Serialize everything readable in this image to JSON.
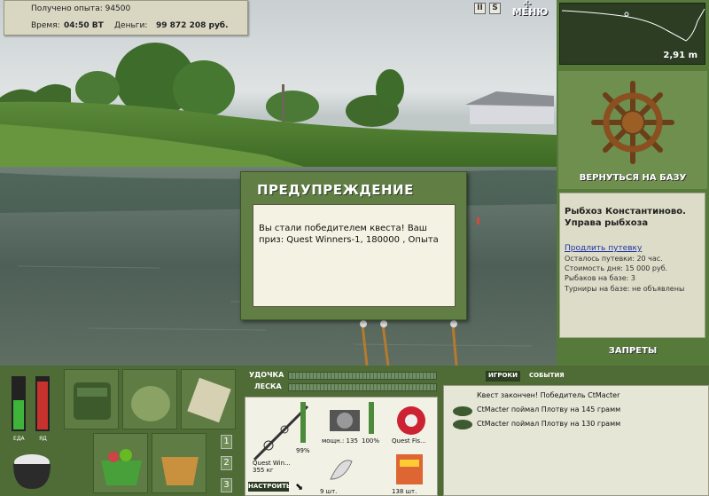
{
  "info": {
    "experience": "Получено опыта: 94500",
    "time_label": "Время:",
    "time_value": "04:50 ВТ",
    "money_label": "Деньги:",
    "money_value": "99 872 208 руб."
  },
  "topbar": {
    "pause": "II",
    "sound": "S",
    "menu_label": "МЕНЮ"
  },
  "depth": {
    "value": "2,91 m"
  },
  "base": {
    "return_label": "ВЕРНУТЬСЯ НА БАЗУ",
    "title": "Рыбхоз Константиново. Управа рыбхоза",
    "extend_link": "Продлить путевку",
    "remaining": "Осталось путевки: 20 час.",
    "day_cost": "Стоимость дня: 15 000 руб.",
    "anglers": "Рыбаков на базе: 3",
    "tournaments": "Турниры на базе: не объявлены",
    "bans_label": "ЗАПРЕТЫ"
  },
  "dialog": {
    "title": "ПРЕДУПРЕЖДЕНИЕ",
    "message": "Вы стали победителем квеста! Ваш приз: Quest Winners-1, 180000 , Опыта"
  },
  "meters": {
    "food_label": "ЕДА",
    "poison_label": "ЯД",
    "food_level": 0.55,
    "poison_level": 0.9
  },
  "pages": [
    "1",
    "2",
    "3"
  ],
  "tackle": {
    "rod_label": "УДОЧКА",
    "line_label": "ЛЕСКА",
    "rod_name": "Quest Win...",
    "rod_weight": "355 кг",
    "rod_pct": "99%",
    "reel_power": "мощн.: 135",
    "reel_pct": "100%",
    "line_name": "Quest Fis...",
    "hooks_count": "9 шт.",
    "bait_count": "138 шт.",
    "setup_button": "НАСТРОИТЬ"
  },
  "events": {
    "tab_players": "ИГРОКИ",
    "tab_events": "СОБЫТИЯ",
    "items": [
      "Квест закончен! Победитель CtMacter",
      "CtMacter поймал Плотву на 145 грамм",
      "CtMacter поймал Плотву на 130 грамм"
    ]
  },
  "colors": {
    "panel_green": "#567a3a",
    "dialog_green": "#617f45",
    "paper": "#f4f2e2",
    "link": "#2033a6"
  }
}
